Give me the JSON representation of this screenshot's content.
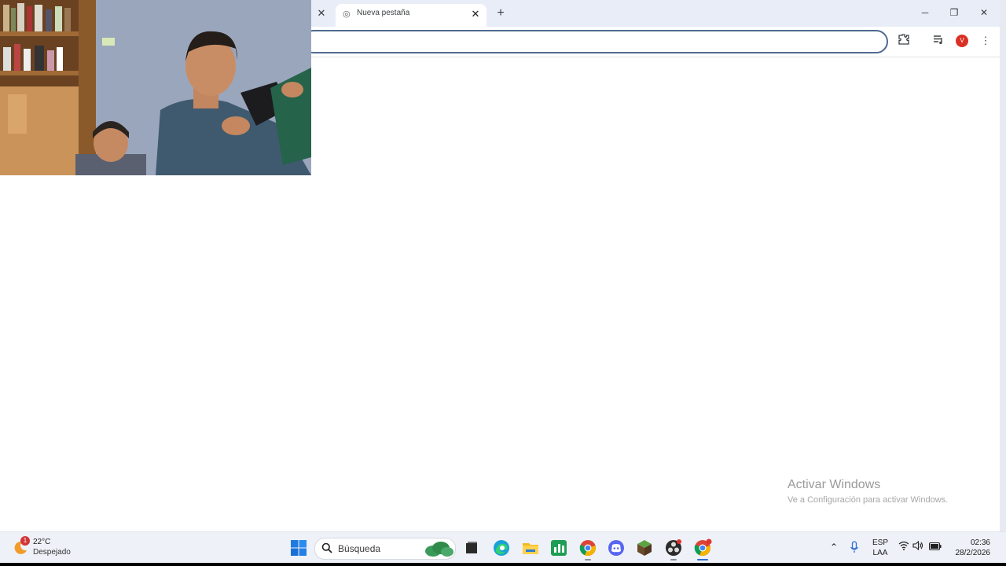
{
  "browser": {
    "tabs": [
      {
        "title": "Nueva pestaña",
        "active": true
      }
    ],
    "prev_tab_close_icon": "close-icon",
    "new_tab_icon": "plus-icon",
    "profile_initial": "V",
    "omnibox_value": ""
  },
  "watermark": {
    "title": "Activar Windows",
    "subtitle": "Ve a Configuración para activar Windows."
  },
  "taskbar": {
    "weather": {
      "badge": "1",
      "temp": "22°C",
      "condition": "Despejado"
    },
    "search_placeholder": "Búsqueda",
    "apps": [
      "windows-start",
      "task-view",
      "edge",
      "file-explorer",
      "spreadsheet",
      "chrome",
      "discord",
      "minecraft",
      "obs",
      "chrome-active"
    ],
    "tray": {
      "lang_line1": "ESP",
      "lang_line2": "LAA",
      "time": "02:36",
      "date": "28/2/2026"
    }
  },
  "colors": {
    "tabbar_bg": "#e8edf7",
    "omnibox_border": "#4f6a8f",
    "taskbar_bg": "#eef1f7",
    "accent": "#2f6ed3"
  }
}
